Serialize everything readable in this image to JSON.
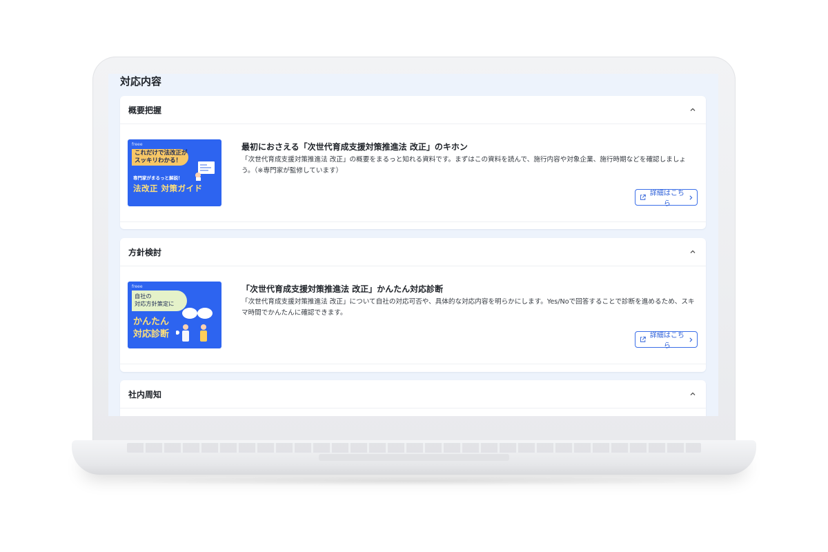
{
  "page": {
    "title": "対応内容"
  },
  "sections": [
    {
      "heading": "概要把握",
      "resource": {
        "title": "最初におさえる「次世代育成支援対策推進法 改正」のキホン",
        "description": "「次世代育成支援対策推進法 改正」の概要をまるっと知れる資料です。まずはこの資料を読んで、施行内容や対象企業、施行時期などを確認しましょう。（※専門家が監修しています）",
        "button_label": "詳細はこちら",
        "thumbnail": {
          "logo": "freee",
          "pill_line1": "これだけで法改正が",
          "pill_line2": "スッキリわかる！",
          "subtitle": "専門家がまるっと解説！",
          "main": "法改正 対策ガイド"
        }
      }
    },
    {
      "heading": "方針検討",
      "resource": {
        "title": "「次世代育成支援対策推進法 改正」かんたん対応診断",
        "description": "「次世代育成支援対策推進法 改正」について自社の対応可否や、具体的な対応内容を明らかにします。Yes/Noで回答することで診断を進めるため、スキマ時間でかんたんに確認できます。",
        "button_label": "詳細はこちら",
        "thumbnail": {
          "logo": "freee",
          "pill_line1": "自社の",
          "pill_line2": "対応方針策定に",
          "main_line1": "かんたん",
          "main_line2": "対応診断"
        }
      }
    },
    {
      "heading": "社内周知"
    }
  ],
  "colors": {
    "accent": "#2c5fd8",
    "thumbnail_bg": "#2d64f0",
    "screen_bg": "#edf3fc"
  },
  "icons": {
    "collapse": "chevron-up-icon",
    "external": "external-link-icon",
    "arrow": "chevron-right-icon"
  }
}
